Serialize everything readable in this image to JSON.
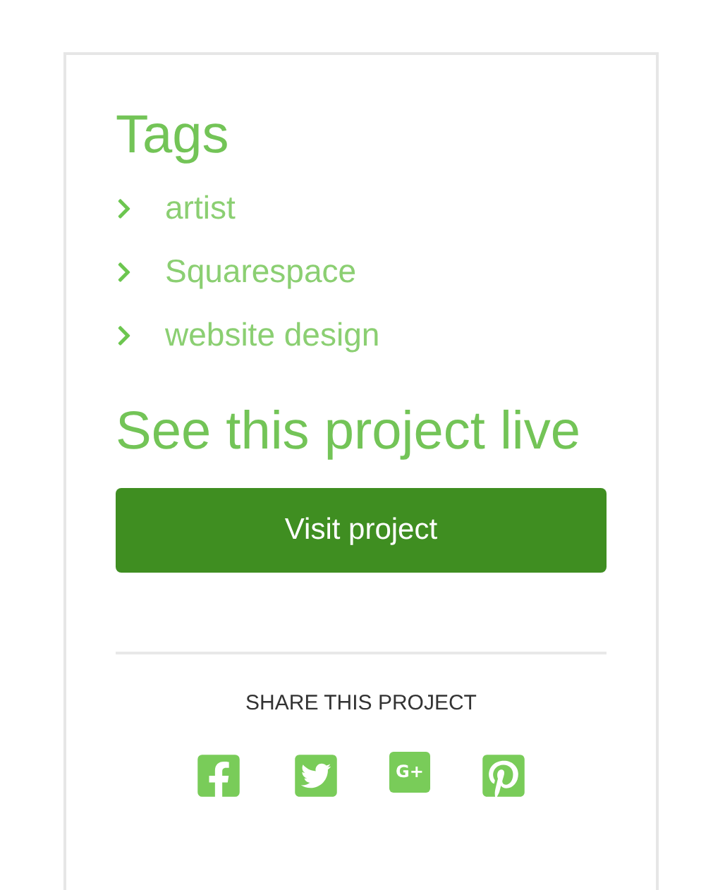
{
  "tags": {
    "title": "Tags",
    "items": [
      "artist",
      "Squarespace",
      "website design"
    ]
  },
  "live": {
    "title": "See this project live",
    "button": "Visit project"
  },
  "share": {
    "title": "SHARE THIS PROJECT",
    "buttons": [
      {
        "kind": "facebook"
      },
      {
        "kind": "twitter"
      },
      {
        "kind": "gplus",
        "label": "G+"
      },
      {
        "kind": "pinterest"
      }
    ]
  }
}
